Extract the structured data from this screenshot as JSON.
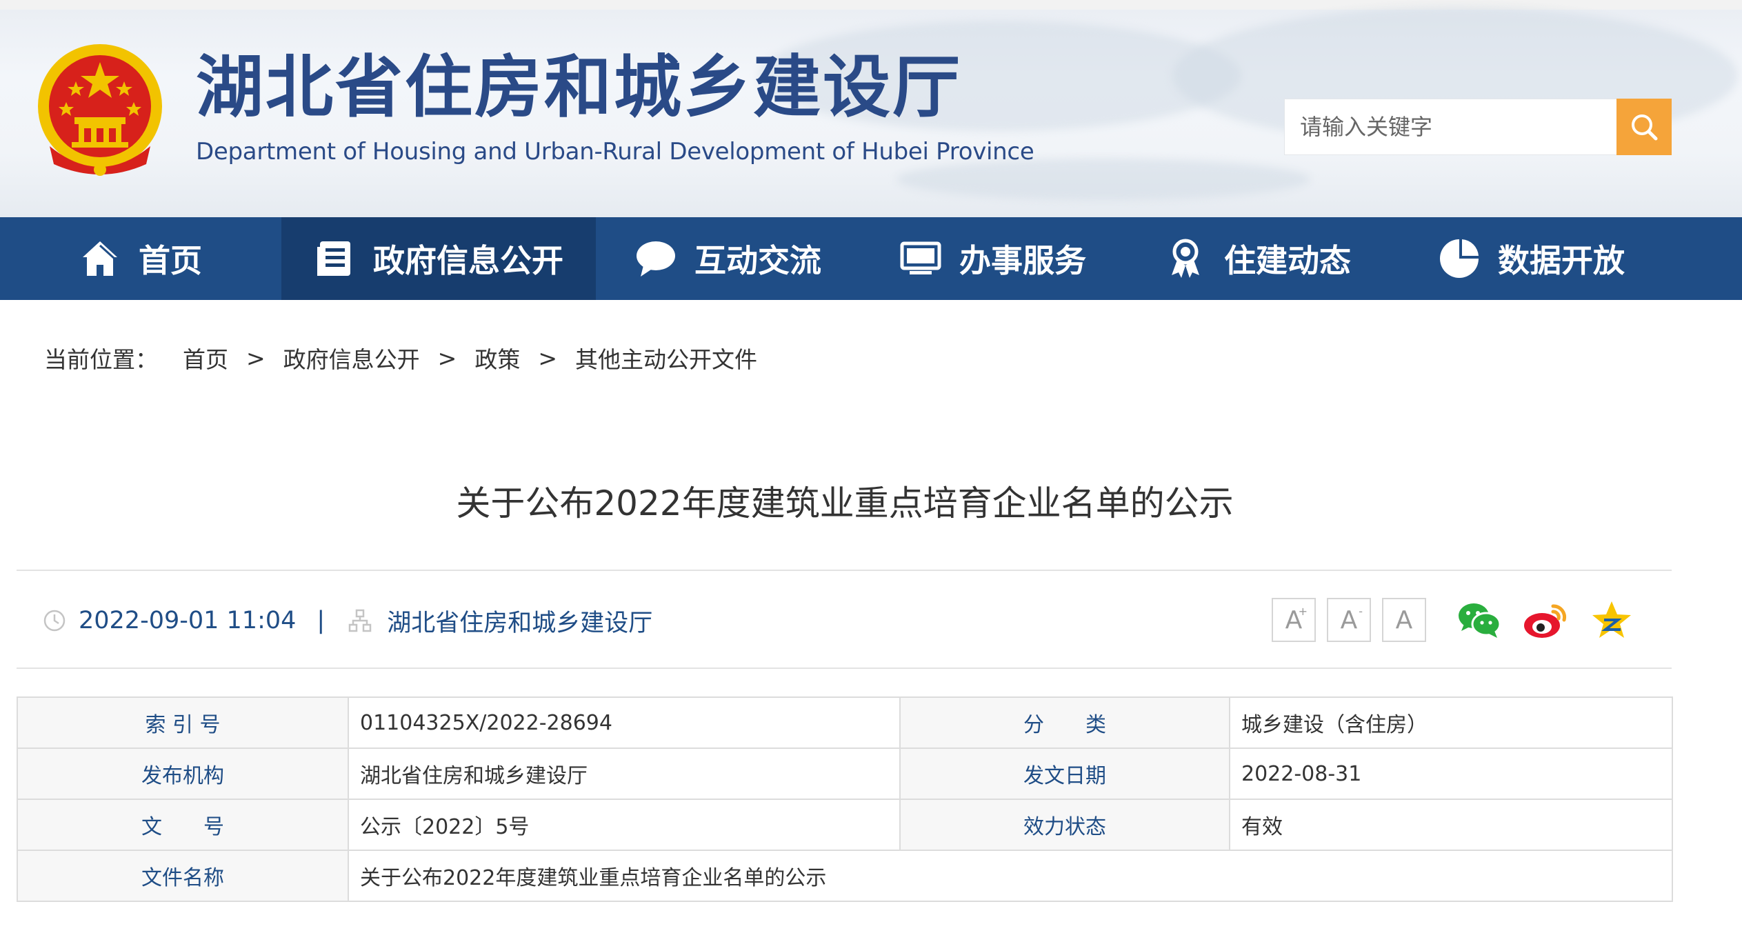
{
  "header": {
    "title": "湖北省住房和城乡建设厅",
    "subtitle": "Department of Housing and Urban-Rural Development of Hubei Province",
    "emblem_icon": "national-emblem-icon",
    "search": {
      "placeholder": "请输入关键字",
      "value": "",
      "button_icon": "search-icon"
    }
  },
  "nav": {
    "items": [
      {
        "label": "首页",
        "icon": "home-icon"
      },
      {
        "label": "政府信息公开",
        "icon": "document-list-icon",
        "active": true
      },
      {
        "label": "互动交流",
        "icon": "chat-bubble-icon"
      },
      {
        "label": "办事服务",
        "icon": "monitor-icon"
      },
      {
        "label": "住建动态",
        "icon": "award-icon"
      },
      {
        "label": "数据开放",
        "icon": "pie-chart-icon"
      }
    ]
  },
  "breadcrumb": {
    "lead": "当前位置：",
    "items": [
      "首页",
      "政府信息公开",
      "政策",
      "其他主动公开文件"
    ],
    "separator": ">"
  },
  "article": {
    "title": "关于公布2022年度建筑业重点培育企业名单的公示",
    "datetime": "2022-09-01 11:04",
    "divider": "|",
    "source": "湖北省住房和城乡建设厅",
    "font_tools": [
      {
        "label": "A",
        "modifier": "+"
      },
      {
        "label": "A",
        "modifier": "-"
      },
      {
        "label": "A",
        "modifier": ""
      }
    ],
    "share": [
      "wechat-icon",
      "weibo-icon",
      "qzone-icon"
    ]
  },
  "info_table": {
    "rows": [
      {
        "k1": "索 引 号",
        "v1": "01104325X/2022-28694",
        "k2": "分　　类",
        "v2": "城乡建设（含住房）"
      },
      {
        "k1": "发布机构",
        "v1": "湖北省住房和城乡建设厅",
        "k2": "发文日期",
        "v2": "2022-08-31"
      },
      {
        "k1": "文　　号",
        "v1": "公示〔2022〕5号",
        "k2": "效力状态",
        "v2": "有效"
      },
      {
        "k1": "文件名称",
        "v1": "关于公布2022年度建筑业重点培育企业名单的公示"
      }
    ]
  },
  "colors": {
    "nav_bg": "#1f4d86",
    "nav_active": "#173d6e",
    "brand_blue": "#2a4a87",
    "search_accent": "#f5a43a",
    "emblem_red": "#d7211b",
    "emblem_gold": "#f2c300"
  }
}
